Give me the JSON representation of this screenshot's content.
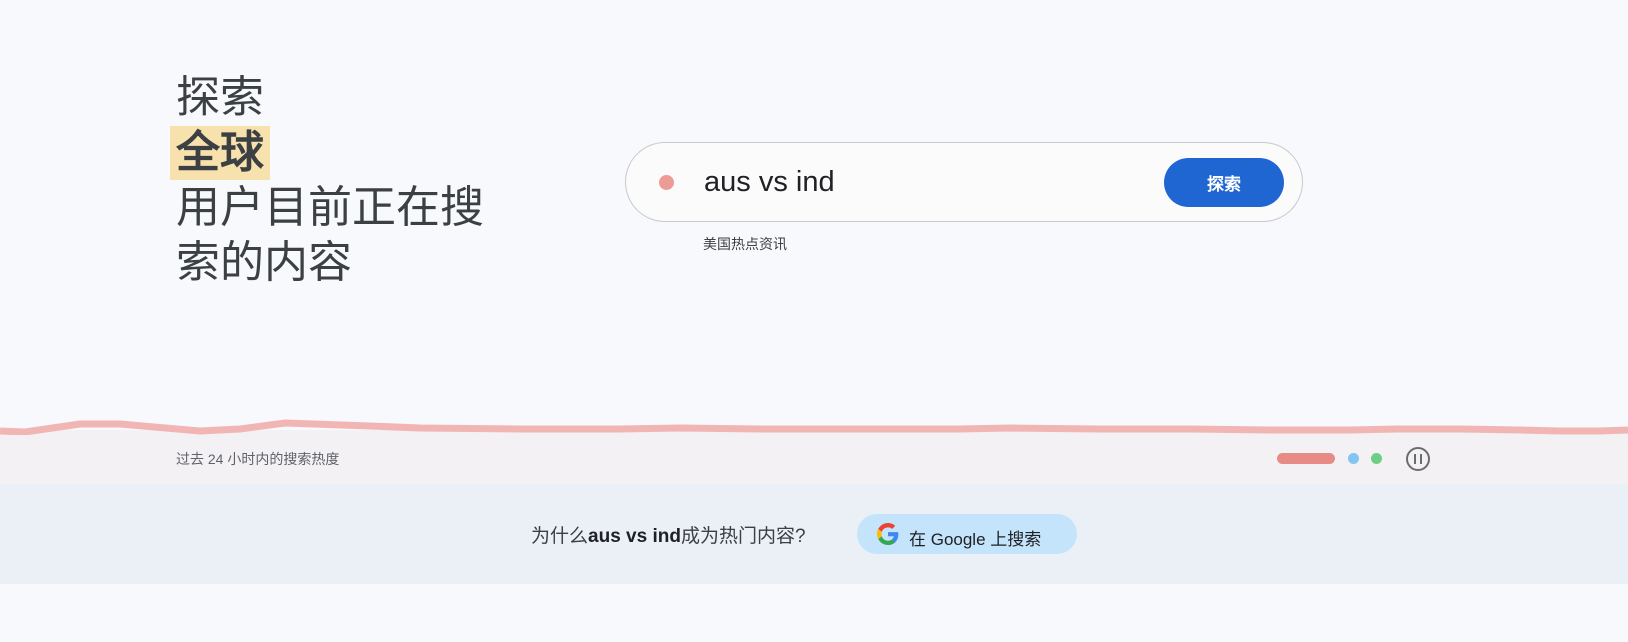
{
  "hero": {
    "line1": "探索",
    "line2_highlight": "全球",
    "line3": "用户目前正在搜",
    "line4": "索的内容"
  },
  "search": {
    "query": "aus vs ind",
    "button_label": "探索",
    "subtitle": "美国热点资讯"
  },
  "trend": {
    "caption": "过去 24 小时内的搜索热度",
    "line_color": "#f1b6b4"
  },
  "pager": {
    "dot_colors": [
      "#e78b87",
      "#81c5f3",
      "#6bcf84"
    ]
  },
  "why": {
    "prefix": "为什么",
    "term": "aus vs ind",
    "suffix": "成为热门内容?",
    "google_button_label": "在 Google 上搜索"
  }
}
